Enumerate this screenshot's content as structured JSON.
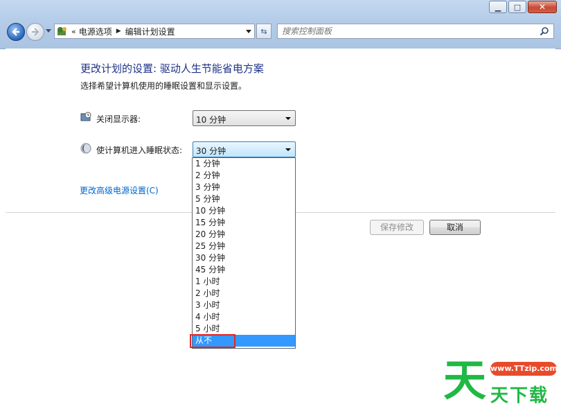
{
  "window": {
    "minimize_icon": "minimize-icon",
    "maximize_icon": "maximize-icon",
    "close_icon": "close-icon"
  },
  "toolbar": {
    "breadcrumb_prefix": "«",
    "breadcrumb": [
      "电源选项",
      "编辑计划设置"
    ],
    "breadcrumb_sep": "▶",
    "search_placeholder": "搜索控制面板"
  },
  "main": {
    "title": "更改计划的设置: 驱动人生节能省电方案",
    "subtitle": "选择希望计算机使用的睡眠设置和显示设置。",
    "display_off": {
      "label": "关闭显示器:",
      "value": "10 分钟"
    },
    "sleep": {
      "label": "使计算机进入睡眠状态:",
      "value": "30 分钟"
    },
    "advanced_link": "更改高级电源设置(C)",
    "save_button": "保存修改",
    "cancel_button": "取消"
  },
  "dropdown": {
    "options": [
      "1 分钟",
      "2 分钟",
      "3 分钟",
      "5 分钟",
      "10 分钟",
      "15 分钟",
      "20 分钟",
      "25 分钟",
      "30 分钟",
      "45 分钟",
      "1 小时",
      "2 小时",
      "3 小时",
      "4 小时",
      "5 小时",
      "从不"
    ],
    "selected": "从不"
  },
  "watermark": {
    "big_char": "天",
    "site": "www.TTzip.com",
    "text": "天下载"
  },
  "colors": {
    "title_blue": "#1e3287",
    "link_blue": "#0066cc",
    "selection": "#3399ff",
    "highlight_red": "#e0262b",
    "watermark_green": "#1fb944"
  }
}
